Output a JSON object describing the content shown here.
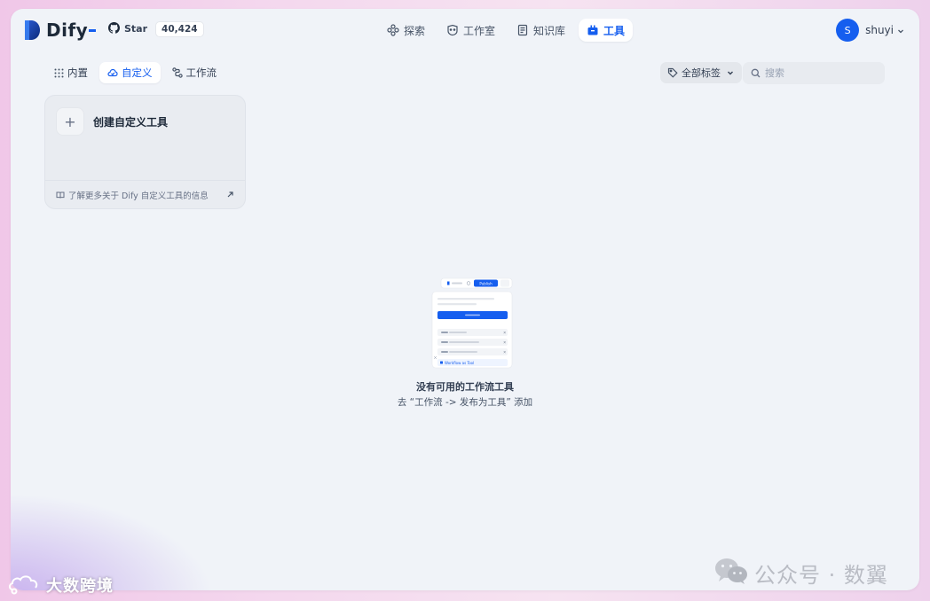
{
  "brand": {
    "name": "Dify"
  },
  "github": {
    "star_label": "Star",
    "star_count": "40,424"
  },
  "nav": {
    "items": [
      {
        "label": "探索",
        "icon": "explore-icon"
      },
      {
        "label": "工作室",
        "icon": "studio-icon"
      },
      {
        "label": "知识库",
        "icon": "knowledge-icon"
      },
      {
        "label": "工具",
        "icon": "tools-icon",
        "active": true
      }
    ]
  },
  "user": {
    "initial": "S",
    "name": "shuyi"
  },
  "tabs": [
    {
      "label": "内置",
      "icon": "grid-icon"
    },
    {
      "label": "自定义",
      "icon": "custom-icon",
      "active": true
    },
    {
      "label": "工作流",
      "icon": "workflow-icon"
    }
  ],
  "filter": {
    "tags_label": "全部标签",
    "search_placeholder": "搜索"
  },
  "create_card": {
    "title": "创建自定义工具",
    "plus": "+",
    "footer_link": "了解更多关于 Dify 自定义工具的信息"
  },
  "empty_state": {
    "title": "没有可用的工作流工具",
    "description": "去 “工作流 -> 发布为工具” 添加",
    "illustration": {
      "publish_label": "Publish",
      "tool_label": "Workflow as Tool"
    }
  },
  "watermarks": {
    "right": "公众号 · 数翼",
    "left": "大数跨境"
  },
  "colors": {
    "accent": "#155eef",
    "background": "#f0f3f8"
  }
}
